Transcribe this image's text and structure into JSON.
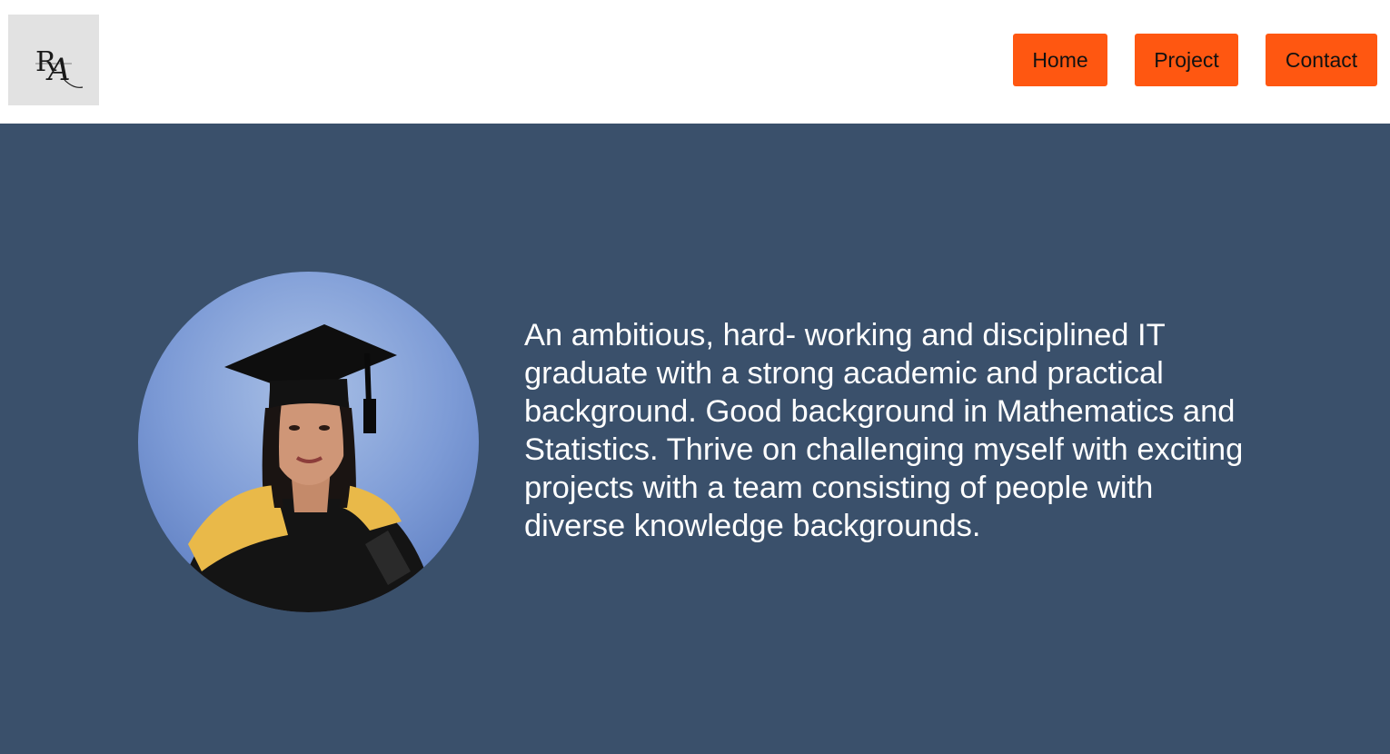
{
  "header": {
    "logo": {
      "icon": "monogram-logo",
      "text": "RA"
    },
    "nav": [
      {
        "label": "Home"
      },
      {
        "label": "Project"
      },
      {
        "label": "Contact"
      }
    ]
  },
  "hero": {
    "portrait": {
      "icon": "graduate-portrait-photo"
    },
    "bio": "An ambitious, hard- working and disciplined IT graduate with a strong academic and practical background. Good background in Mathematics and Statistics. Thrive on challenging myself with exciting projects with a team consisting of people with diverse knowledge backgrounds."
  },
  "colors": {
    "accent": "#ff5711",
    "hero_bg": "#3a506b",
    "header_bg": "#ffffff",
    "logo_bg": "#e2e2e2"
  }
}
